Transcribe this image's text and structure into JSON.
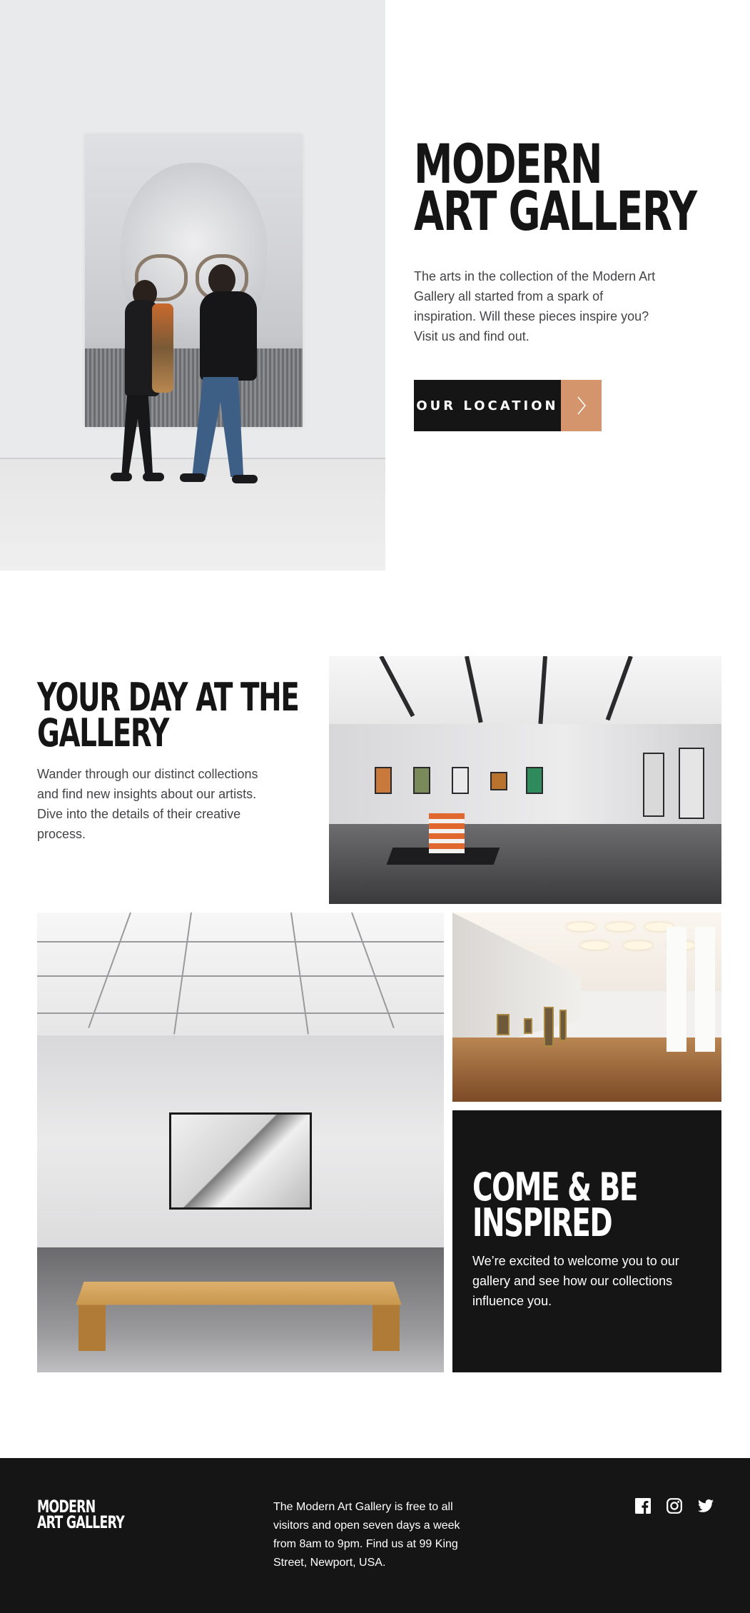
{
  "hero": {
    "title_line1": "MODERN",
    "title_line2": "ART GALLERY",
    "description": "The arts in the collection of the Modern Art Gallery all started from a spark of inspiration. Will these pieces inspire you? Visit us and find out.",
    "button_label": "OUR LOCATION",
    "button_arrow_icon": "chevron-right-icon"
  },
  "day_section": {
    "title_line1": "YOUR DAY AT THE",
    "title_line2": "GALLERY",
    "description": "Wander through our distinct collections and find new insights about our artists. Dive into the details of their creative process."
  },
  "inspired_section": {
    "title_line1": "COME & BE",
    "title_line2": "INSPIRED",
    "description": "We’re excited to welcome you to our gallery and see how our collections influence you."
  },
  "footer": {
    "logo_line1": "MODERN",
    "logo_line2": "ART GALLERY",
    "info": "The Modern Art Gallery is free to all visitors and open seven days a week from 8am to 9pm. Find us at 99 King Street, Newport, USA.",
    "social_icons": [
      "facebook-icon",
      "instagram-icon",
      "twitter-icon"
    ]
  },
  "colors": {
    "dark": "#151515",
    "accent": "#d5956c",
    "body_text": "#444448",
    "white": "#ffffff"
  }
}
